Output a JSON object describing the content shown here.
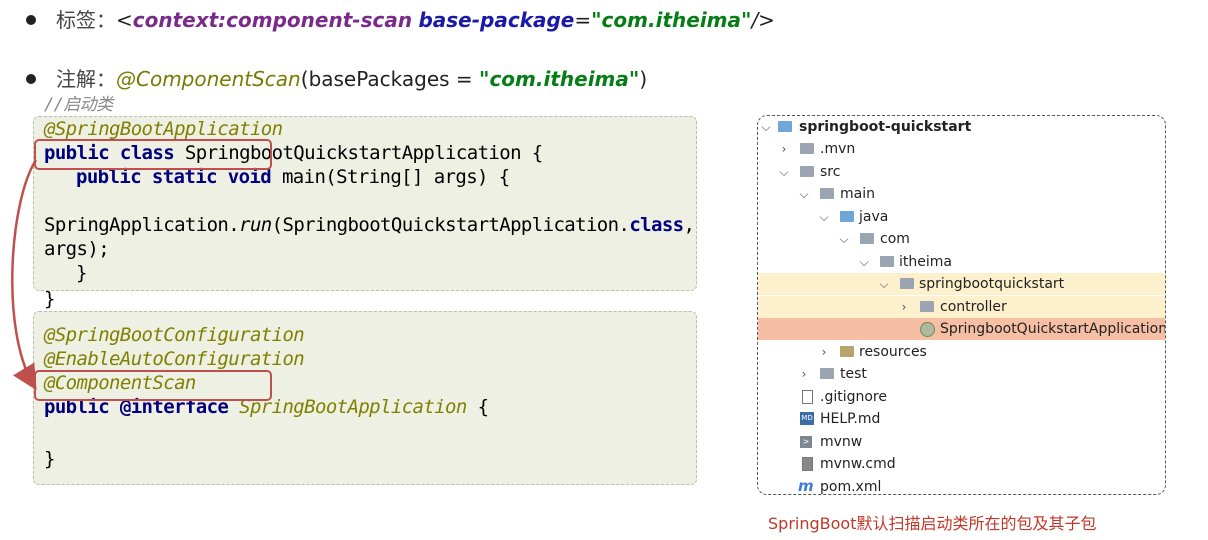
{
  "bullet1": {
    "label": "标签：",
    "open": "<",
    "tag": "context:component-scan",
    "attr": "base-package",
    "eq": "=",
    "value": "\"com.itheima\"",
    "close": "/>"
  },
  "bullet2": {
    "label": "注解：",
    "annotation": "@ComponentScan",
    "paren_open": "(",
    "param": "basePackages = ",
    "value": "\"com.itheima\"",
    "paren_close": ")"
  },
  "code1": {
    "comment": "//启动类",
    "line1": "@SpringBootApplication",
    "line2_kw": "public class",
    "line2_rest": " SpringbootQuickstartApplication {",
    "line3_kw": "public static void",
    "line3_rest": " main(String[] args) {",
    "line4_a": "SpringApplication.",
    "line4_run": "run",
    "line4_b": "(SpringbootQuickstartApplication.",
    "line4_class": "class",
    "line4_c": ",",
    "line5": "args);",
    "line6": "}",
    "line7": "}"
  },
  "code2": {
    "line1": "@SpringBootConfiguration",
    "line2": "@EnableAutoConfiguration",
    "line3": "@ComponentScan",
    "line4_kw": "public @interface",
    "line4_rest": " SpringBootApplication",
    "line4_brace": " {",
    "line5": "}"
  },
  "tree": [
    {
      "name": "springboot-quickstart",
      "chevron": "⌵"
    },
    {
      "name": ".mvn",
      "chevron": "›"
    },
    {
      "name": "src",
      "chevron": "⌵"
    },
    {
      "name": "main",
      "chevron": "⌵"
    },
    {
      "name": "java",
      "chevron": "⌵"
    },
    {
      "name": "com",
      "chevron": "⌵"
    },
    {
      "name": "itheima",
      "chevron": "⌵"
    },
    {
      "name": "springbootquickstart",
      "chevron": "⌵"
    },
    {
      "name": "controller",
      "chevron": "›"
    },
    {
      "name": "SpringbootQuickstartApplication",
      "chevron": ""
    },
    {
      "name": "resources",
      "chevron": "›"
    },
    {
      "name": "test",
      "chevron": "›"
    },
    {
      "name": ".gitignore",
      "chevron": ""
    },
    {
      "name": "HELP.md",
      "chevron": ""
    },
    {
      "name": "mvnw",
      "chevron": ""
    },
    {
      "name": "mvnw.cmd",
      "chevron": ""
    },
    {
      "name": "pom.xml",
      "chevron": ""
    }
  ],
  "caption": "SpringBoot默认扫描启动类所在的包及其子包",
  "colors": {
    "highlight_border": "#c0504d",
    "panel_bg": "#eef0e3",
    "row_yellow": "#fdf0cc",
    "row_orange": "#f6bfa4",
    "caption": "#c0392b"
  }
}
